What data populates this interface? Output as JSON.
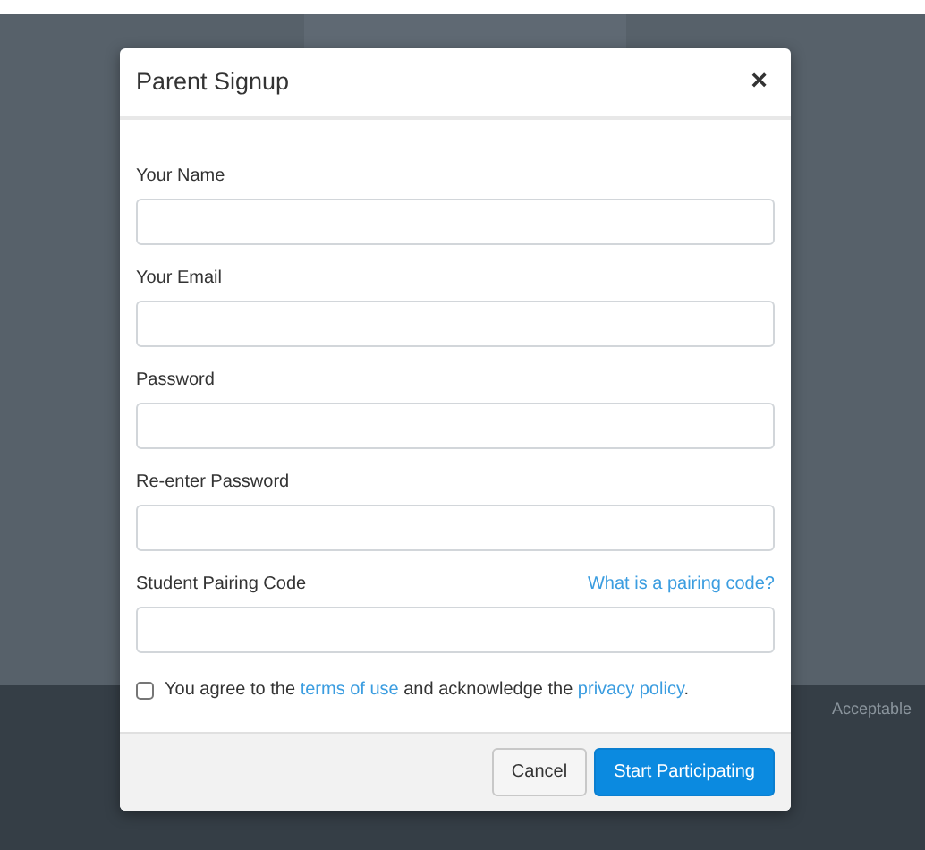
{
  "background": {
    "footer_link": "Acceptable"
  },
  "dialog": {
    "title": "Parent Signup",
    "close": "×",
    "fields": [
      {
        "label": "Your Name"
      },
      {
        "label": "Your Email"
      },
      {
        "label": "Password"
      },
      {
        "label": "Re-enter Password"
      },
      {
        "label": "Student Pairing Code",
        "help_link": "What is a pairing code?"
      }
    ],
    "agreement": {
      "checked": false,
      "parts": [
        {
          "kind": "text",
          "text": "You agree to the "
        },
        {
          "kind": "link",
          "text": "terms of use"
        },
        {
          "kind": "text",
          "text": " and acknowledge the "
        },
        {
          "kind": "link",
          "text": "privacy policy"
        },
        {
          "kind": "text",
          "text": "."
        }
      ]
    },
    "buttons": [
      {
        "label": "Cancel",
        "kind": "secondary"
      },
      {
        "label": "Start Participating",
        "kind": "primary"
      }
    ]
  }
}
